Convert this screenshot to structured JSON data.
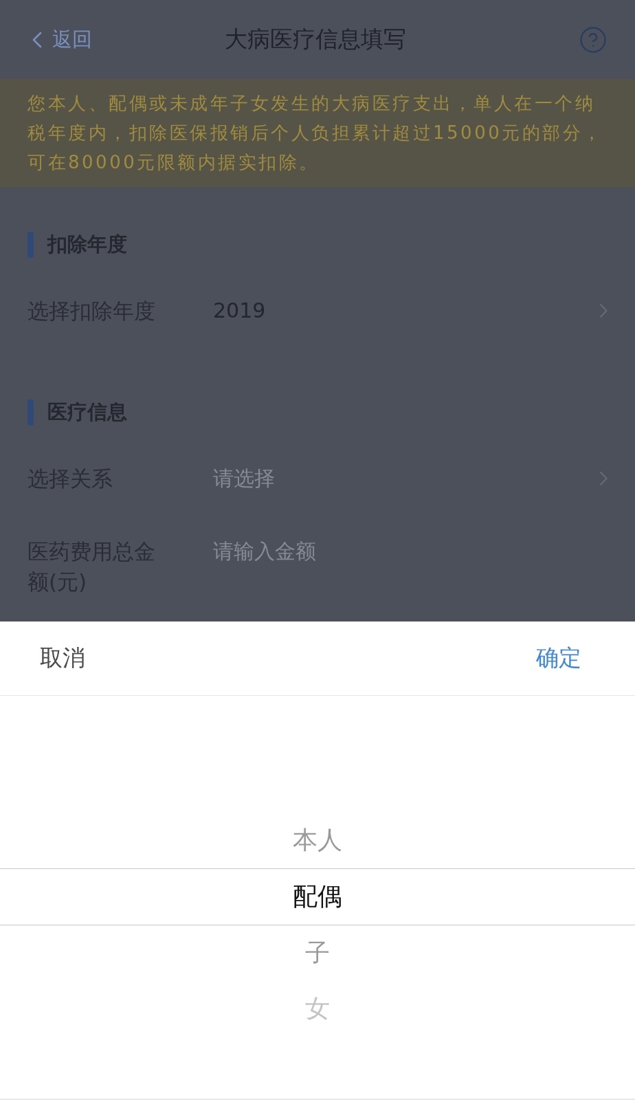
{
  "nav": {
    "back": "返回",
    "title": "大病医疗信息填写"
  },
  "notice": "您本人、配偶或未成年子女发生的大病医疗支出，单人在一个纳税年度内，扣除医保报销后个人负担累计超过15000元的部分，可在80000元限额内据实扣除。",
  "sections": [
    {
      "title": "扣除年度",
      "rows": [
        {
          "kind": "select",
          "label": "选择扣除年度",
          "value": "2019"
        }
      ]
    },
    {
      "title": "医疗信息",
      "rows": [
        {
          "kind": "select",
          "label": "选择关系",
          "placeholder": "请选择"
        },
        {
          "kind": "input",
          "label": "医药费用总金额(元)",
          "placeholder": "请输入金额"
        }
      ]
    }
  ],
  "picker": {
    "cancel": "取消",
    "confirm": "确定",
    "options": [
      {
        "label": "本人",
        "selected": false
      },
      {
        "label": "配偶",
        "selected": true
      },
      {
        "label": "子",
        "selected": false
      },
      {
        "label": "女",
        "selected": false
      }
    ]
  }
}
